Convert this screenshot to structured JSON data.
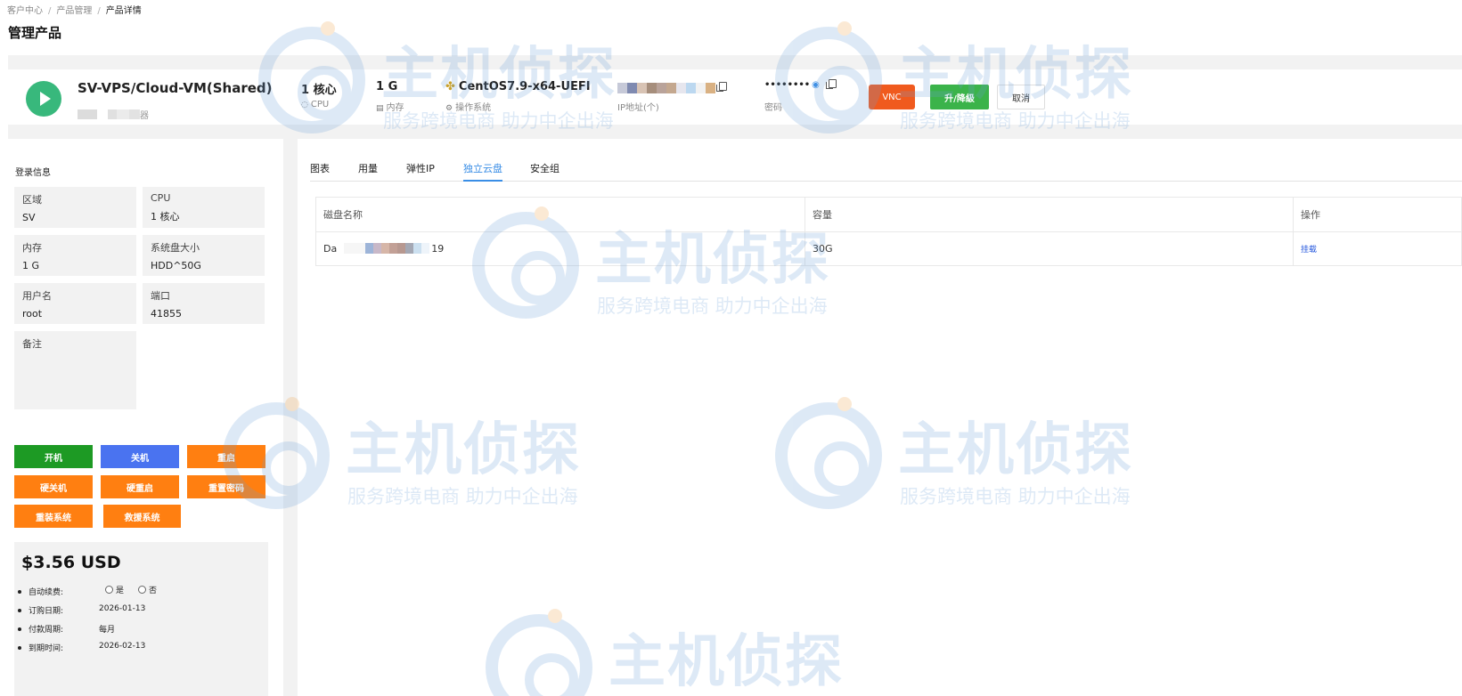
{
  "breadcrumb": {
    "item1": "客户中心",
    "item2": "产品管理",
    "item3": "产品详情",
    "separator": "/"
  },
  "page_title": "管理产品",
  "product": {
    "name": "SV-VPS/Cloud-VM(Shared)",
    "sub_suffix": "器",
    "cpu_value": "1 核心",
    "cpu_label": "CPU",
    "mem_value": "1 G",
    "mem_label": "内存",
    "os_value": "CentOS7.9-x64-UEFI",
    "os_label": "操作系统",
    "ip_label": "IP地址(个)",
    "password_value": "••••••••",
    "password_label": "密码",
    "vnc_label": "VNC",
    "resize_label": "升/降級",
    "cancel_label": "取消"
  },
  "login_info": {
    "title": "登录信息",
    "region_key": "区域",
    "region_val": "SV",
    "cpu_key": "CPU",
    "cpu_val": "1 核心",
    "mem_key": "内存",
    "mem_val": "1 G",
    "disk_key": "系统盘大小",
    "disk_val": "HDD^50G",
    "user_key": "用户名",
    "user_val": "root",
    "port_key": "端口",
    "port_val": "41855",
    "note_key": "备注"
  },
  "actions": {
    "power_on": "开机",
    "power_off": "关机",
    "restart": "重启",
    "hard_off": "硬关机",
    "hard_restart": "硬重启",
    "reset_password": "重置密码",
    "reinstall": "重装系统",
    "rescue": "救援系统"
  },
  "billing": {
    "price": "$3.56 USD",
    "auto_renew_key": "自动续费:",
    "yes": "是",
    "no": "否",
    "order_date_key": "订购日期:",
    "order_date_val": "2026-01-13",
    "cycle_key": "付款周期:",
    "cycle_val": "每月",
    "expire_key": "到期时间:",
    "expire_val": "2026-02-13"
  },
  "tabs": [
    "图表",
    "用量",
    "弹性IP",
    "独立云盘",
    "安全组"
  ],
  "active_tab": "独立云盘",
  "disk_table": {
    "headers": [
      "磁盘名称",
      "容量",
      "操作"
    ],
    "rows": [
      {
        "name_prefix": "Da",
        "name_suffix": "19",
        "capacity": "30G",
        "action": "挂载"
      }
    ]
  },
  "watermark": {
    "brand": "主机侦探",
    "slogan": "服务跨境电商  助力中企出海"
  },
  "colors": {
    "accent": "#3a8ee6",
    "green": "#1d9a24",
    "blue": "#4a73f0",
    "orange": "#ff7f11",
    "vnc": "#f05a1e",
    "resize": "#3bb34a"
  }
}
